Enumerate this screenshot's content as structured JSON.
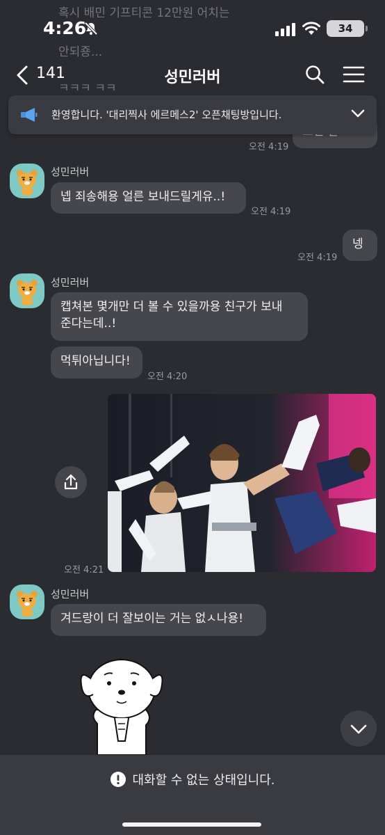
{
  "status": {
    "time": "4:26",
    "battery": "34"
  },
  "ghost": {
    "line1": "혹시 배민 기프티콘 12만원 어치는",
    "line2": "안되죵...",
    "line3": "ㅋㅋㅋ ㅋㅋ"
  },
  "header": {
    "back_count": "141",
    "title": "성민러버"
  },
  "notice": {
    "text": "환영합니다. '대리찍사 에르메스2' 오픈채팅방입니다."
  },
  "messages": {
    "partial_bubble": "으신 잘 ㅎㅎ",
    "t1": "오전 4:19",
    "sender": "성민러버",
    "m1": "넵 죄송해용 얼른 보내드릴게유..!",
    "t2": "오전 4:19",
    "mine": "넹",
    "t3": "오전 4:19",
    "m2_line1": "캡쳐본 몇개만 더 볼 수 있을까용 친구가 보내",
    "m2_line2": "준다는데..!",
    "m3": "먹튀아닙니다!",
    "t4": "오전 4:20",
    "t5": "오전 4:21",
    "m4": "겨드랑이 더 잘보이는 거는 없ㅅ나용!"
  },
  "bottom": {
    "message": "대화할 수 없는 상태입니다."
  },
  "colors": {
    "background": "#2b2c31",
    "bubble": "#46474c",
    "avatar_bg": "#7ec9c4"
  }
}
